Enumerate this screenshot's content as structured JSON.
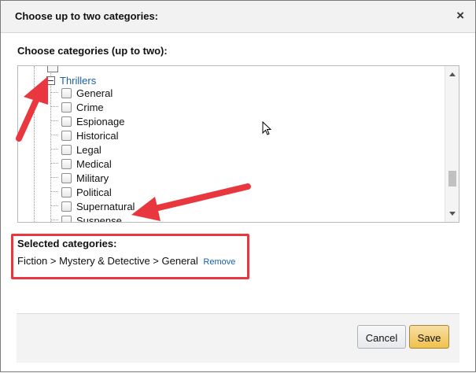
{
  "dialog": {
    "title": "Choose up to two categories:",
    "close_label": "×"
  },
  "tree": {
    "label": "Choose categories (up to two):",
    "parent": {
      "label": "Thrillers",
      "expander": "⊟"
    },
    "items": [
      {
        "label": "General",
        "checked": false
      },
      {
        "label": "Crime",
        "checked": false
      },
      {
        "label": "Espionage",
        "checked": false
      },
      {
        "label": "Historical",
        "checked": false
      },
      {
        "label": "Legal",
        "checked": false
      },
      {
        "label": "Medical",
        "checked": false
      },
      {
        "label": "Military",
        "checked": false
      },
      {
        "label": "Political",
        "checked": false
      },
      {
        "label": "Supernatural",
        "checked": false
      },
      {
        "label": "Suspense",
        "checked": false
      }
    ]
  },
  "selected": {
    "label": "Selected categories:",
    "value": "Fiction > Mystery & Detective > General",
    "remove_label": "Remove"
  },
  "footer": {
    "cancel_label": "Cancel",
    "save_label": "Save"
  },
  "colors": {
    "annotation_arrow": "#e8373f",
    "link": "#1a5fa8",
    "save_button": "#f0c14b"
  }
}
